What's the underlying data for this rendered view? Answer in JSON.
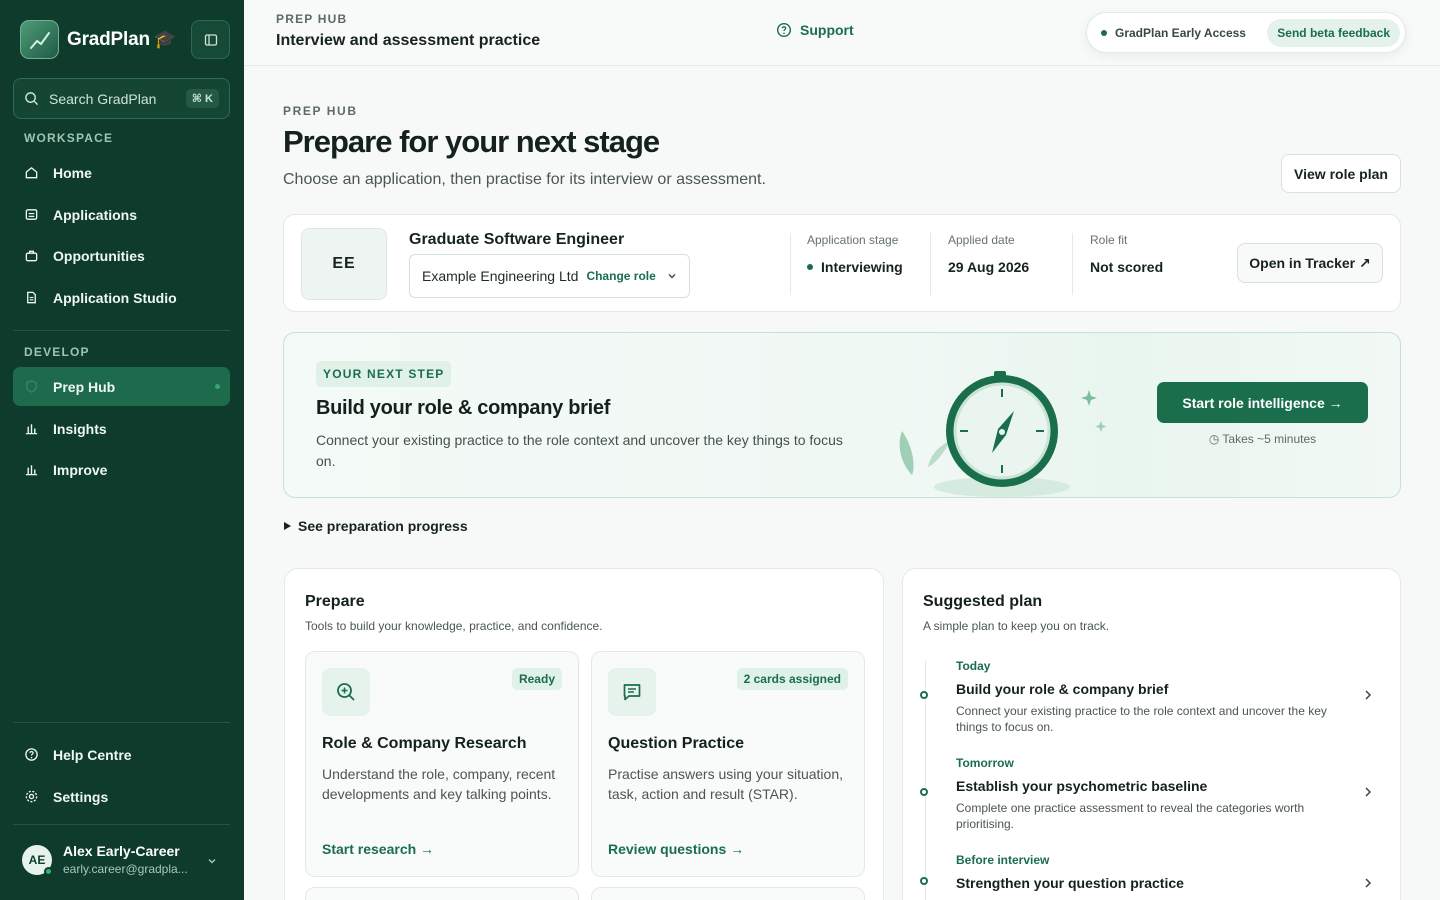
{
  "brand": {
    "name": "GradPlan",
    "cap_emoji": "🎓"
  },
  "search": {
    "placeholder": "Search GradPlan",
    "shortcut": "⌘ K"
  },
  "sidebar": {
    "workspace_label": "WORKSPACE",
    "develop_label": "DEVELOP",
    "workspace_items": [
      {
        "label": "Home",
        "icon": "home-icon"
      },
      {
        "label": "Applications",
        "icon": "applications-icon"
      },
      {
        "label": "Opportunities",
        "icon": "briefcase-icon"
      },
      {
        "label": "Application Studio",
        "icon": "document-icon"
      }
    ],
    "develop_items": [
      {
        "label": "Prep Hub",
        "icon": "shield-icon",
        "active": true
      },
      {
        "label": "Insights",
        "icon": "bar-chart-icon"
      },
      {
        "label": "Improve",
        "icon": "bar-chart-icon"
      }
    ],
    "footer_items": [
      {
        "label": "Help Centre",
        "icon": "help-icon"
      },
      {
        "label": "Settings",
        "icon": "gear-icon"
      }
    ]
  },
  "user": {
    "initials": "AE",
    "name": "Alex Early-Career",
    "email": "early.career@gradpla..."
  },
  "topbar": {
    "kicker": "PREP HUB",
    "title": "Interview and assessment practice",
    "support": "Support",
    "beta_label": "GradPlan Early Access",
    "beta_button": "Send beta feedback"
  },
  "header": {
    "kicker": "PREP HUB",
    "title": "Prepare for your next stage",
    "subtitle": "Choose an application, then practise for its interview or assessment.",
    "view_role_plan": "View role plan"
  },
  "role": {
    "logo_initials": "EE",
    "title": "Graduate Software Engineer",
    "company": "Example Engineering Ltd",
    "change_role": "Change role",
    "stage_label": "Application stage",
    "stage_value": "Interviewing",
    "applied_label": "Applied date",
    "applied_value": "29 Aug 2026",
    "fit_label": "Role fit",
    "fit_value": "Not scored",
    "open_tracker": "Open in Tracker ↗"
  },
  "next_step": {
    "pill": "YOUR NEXT STEP",
    "title": "Build your role & company brief",
    "description": "Connect your existing practice to the role context and uncover the key things to focus on.",
    "button": "Start role intelligence →",
    "duration": "◷ Takes ~5 minutes"
  },
  "progress_toggle": "See preparation progress",
  "prepare": {
    "title": "Prepare",
    "subtitle": "Tools to build your knowledge, practice, and confidence.",
    "cards": [
      {
        "badge": "Ready",
        "title": "Role & Company Research",
        "description": "Understand the role, company, recent developments and key talking points.",
        "link": "Start research →"
      },
      {
        "badge": "2 cards assigned",
        "title": "Question Practice",
        "description": "Practise answers using your situation, task, action and result (STAR).",
        "link": "Review questions →"
      }
    ]
  },
  "plan": {
    "title": "Suggested plan",
    "subtitle": "A simple plan to keep you on track.",
    "items": [
      {
        "when": "Today",
        "title": "Build your role & company brief",
        "description": "Connect your existing practice to the role context and uncover the key things to focus on."
      },
      {
        "when": "Tomorrow",
        "title": "Establish your psychometric baseline",
        "description": "Complete one practice assessment to reveal the categories worth prioritising."
      },
      {
        "when": "Before interview",
        "title": "Strengthen your question practice",
        "description": ""
      }
    ]
  },
  "colors": {
    "sidebar": "#0e3b2c",
    "accent": "#1a6e4c",
    "active_nav": "#1e6a4c",
    "page_bg": "#f7f9f8"
  }
}
